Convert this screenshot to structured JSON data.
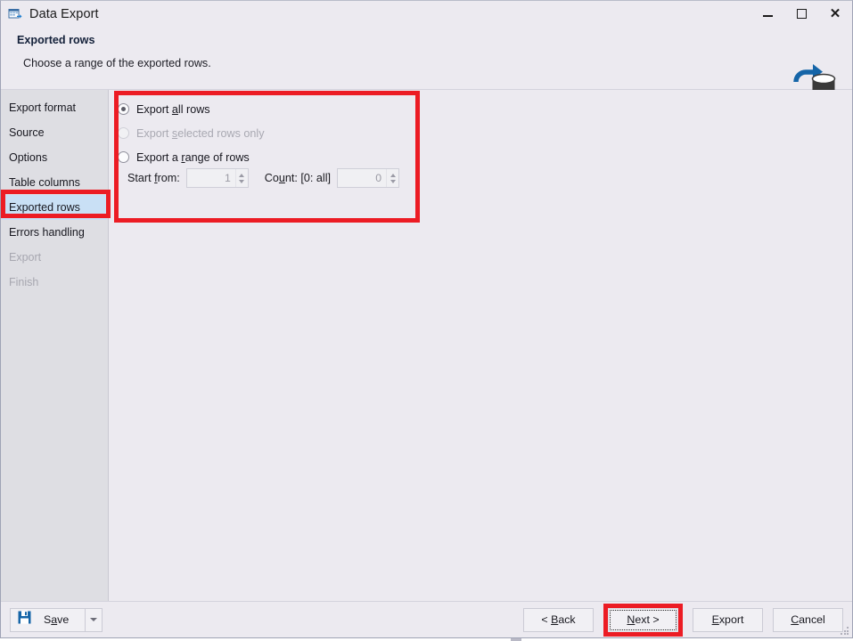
{
  "window": {
    "title": "Data Export",
    "icon": "data-export-icon",
    "controls": {
      "minimize": "minimize-icon",
      "maximize": "maximize-icon",
      "close": "close-icon"
    }
  },
  "header": {
    "title": "Exported rows",
    "subtitle": "Choose a range of the exported rows.",
    "logo": "database-export-logo"
  },
  "sidebar": {
    "items": [
      {
        "label": "Export format",
        "state": "enabled"
      },
      {
        "label": "Source",
        "state": "enabled"
      },
      {
        "label": "Options",
        "state": "enabled"
      },
      {
        "label": "Table columns",
        "state": "enabled"
      },
      {
        "label": "Exported rows",
        "state": "selected"
      },
      {
        "label": "Errors handling",
        "state": "enabled"
      },
      {
        "label": "Export",
        "state": "disabled"
      },
      {
        "label": "Finish",
        "state": "disabled"
      }
    ]
  },
  "main": {
    "radios": [
      {
        "id": "all-rows",
        "label_pre": "Export ",
        "label_accel": "a",
        "label_post": "ll rows",
        "checked": true,
        "disabled": false
      },
      {
        "id": "selected-rows",
        "label_pre": "Export ",
        "label_accel": "s",
        "label_post": "elected rows only",
        "checked": false,
        "disabled": true
      },
      {
        "id": "range-rows",
        "label_pre": "Export a ",
        "label_accel": "r",
        "label_post": "ange of rows",
        "checked": false,
        "disabled": false
      }
    ],
    "range": {
      "start_label_pre": "Start ",
      "start_label_accel": "f",
      "start_label_post": "rom:",
      "start_value": "1",
      "count_label_pre": "Co",
      "count_label_accel": "u",
      "count_label_post": "nt: [0: all]",
      "count_value": "0"
    }
  },
  "footer": {
    "save": {
      "label_pre": "S",
      "label_accel": "a",
      "label_post": "ve",
      "icon": "save-disk-icon",
      "dropdown": "chevron-down-icon"
    },
    "buttons": [
      {
        "id": "back",
        "pre": "< ",
        "accel": "B",
        "post": "ack",
        "focused": false,
        "highlighted": false
      },
      {
        "id": "next",
        "pre": "",
        "accel": "N",
        "post": "ext >",
        "focused": true,
        "highlighted": true
      },
      {
        "id": "export",
        "pre": "",
        "accel": "E",
        "post": "xport",
        "focused": false,
        "highlighted": false
      },
      {
        "id": "cancel",
        "pre": "",
        "accel": "C",
        "post": "ancel",
        "focused": false,
        "highlighted": false
      }
    ]
  },
  "annotations": {
    "highlight_color": "#ec1c24",
    "boxes": [
      "sidebar-exported-rows",
      "main-radio-panel",
      "next-button"
    ]
  },
  "colors": {
    "accent_selected": "#c9e0f5",
    "window_bg": "#eceaf0",
    "sidebar_bg": "#dedee3",
    "brand_blue": "#1565a8",
    "annotation_red": "#ec1c24"
  }
}
